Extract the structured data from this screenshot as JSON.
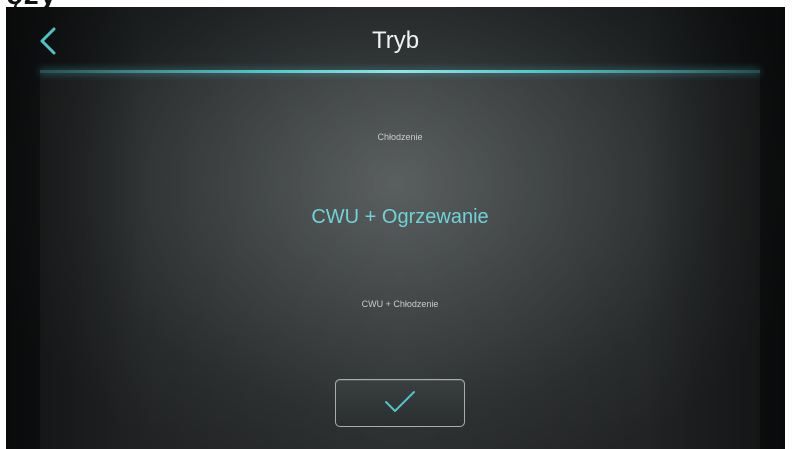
{
  "header": {
    "title": "Tryb",
    "back_icon": "chevron-left-icon"
  },
  "mode_picker": {
    "options": [
      {
        "label": "Chłodzenie",
        "state": "above"
      },
      {
        "label": "CWU + Ogrzewanie",
        "state": "selected"
      },
      {
        "label": "CWU + Chłodzenie",
        "state": "below"
      }
    ]
  },
  "confirm": {
    "icon": "checkmark-icon"
  },
  "colors": {
    "accent": "#4fc3c8",
    "selected_text": "#6fd3d6",
    "background": "#2e3233"
  }
}
